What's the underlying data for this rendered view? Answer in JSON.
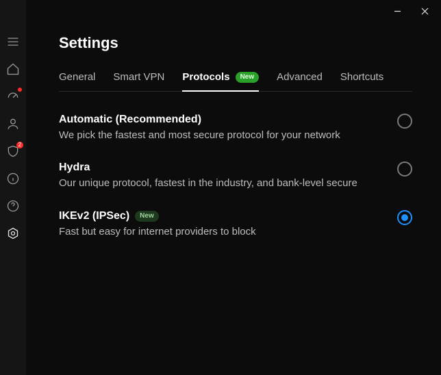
{
  "window": {
    "minimize": "Minimize",
    "close": "Close"
  },
  "sidebar": {
    "items": [
      {
        "id": "menu"
      },
      {
        "id": "home"
      },
      {
        "id": "speed",
        "dot": true
      },
      {
        "id": "account"
      },
      {
        "id": "shield",
        "badge": "2"
      },
      {
        "id": "info"
      },
      {
        "id": "help"
      },
      {
        "id": "settings",
        "active": true
      }
    ]
  },
  "page": {
    "title": "Settings"
  },
  "tabs": [
    {
      "id": "general",
      "label": "General"
    },
    {
      "id": "smartvpn",
      "label": "Smart VPN"
    },
    {
      "id": "protocols",
      "label": "Protocols",
      "badge": "New",
      "active": true
    },
    {
      "id": "advanced",
      "label": "Advanced"
    },
    {
      "id": "shortcuts",
      "label": "Shortcuts"
    }
  ],
  "protocols": {
    "options": [
      {
        "id": "automatic",
        "title": "Automatic (Recommended)",
        "desc": "We pick the fastest and most secure protocol for your network",
        "selected": false
      },
      {
        "id": "hydra",
        "title": "Hydra",
        "desc": "Our unique protocol, fastest in the industry, and bank-level secure",
        "selected": false
      },
      {
        "id": "ikev2",
        "title": "IKEv2 (IPSec)",
        "badge": "New",
        "desc": "Fast but easy for internet providers to block",
        "selected": true
      }
    ]
  }
}
